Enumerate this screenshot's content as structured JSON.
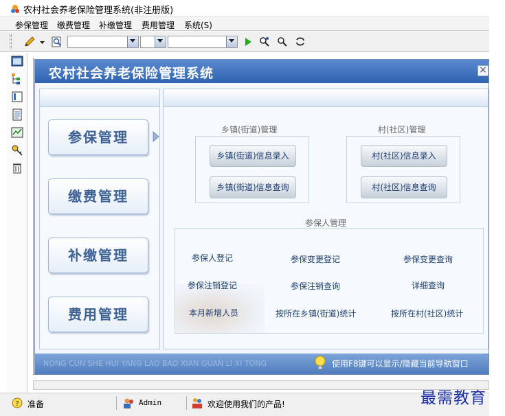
{
  "window": {
    "title": "农村社会养老保险管理系统(非注册版)"
  },
  "menubar": {
    "items": [
      "参保管理",
      "缴费管理",
      "补缴管理",
      "费用管理",
      "系统(S)"
    ]
  },
  "panel": {
    "title": "农村社会养老保险管理系统",
    "close": "×",
    "nav": [
      "参保管理",
      "缴费管理",
      "补缴管理",
      "费用管理"
    ],
    "township_group": {
      "title": "乡镇(街道)管理",
      "buttons": [
        "乡镇(街道)信息录入",
        "乡镇(街道)信息查询"
      ]
    },
    "village_group": {
      "title": "村(社区)管理",
      "buttons": [
        "村(社区)信息录入",
        "村(社区)信息查询"
      ]
    },
    "insured_group": {
      "title": "参保人管理",
      "links": [
        "参保人登记",
        "参保变更登记",
        "参保变更查询",
        "参保注销登记",
        "参保注销查询",
        "详细查询",
        "本月新增人员",
        "按所在乡镇(街道)统计",
        "按所在村(社区)统计"
      ]
    },
    "footer_marquee": "NONG CUN SHE HUI YANG LAO BAO XIAN GUAN LI XI TONG",
    "footer_tip": "使用F8键可以显示/隐藏当前导航窗口"
  },
  "statusbar": {
    "state": "准备",
    "user": "Admin",
    "welcome": "欢迎使用我们的产品!"
  },
  "watermark": "最需教育",
  "colors": {
    "header": "#3a6eb8",
    "nav_text": "#3e6294",
    "link_text": "#1e3f70",
    "watermark": "#1a2fa8"
  },
  "icons": [
    "app-icon",
    "pencil-icon",
    "search-doc-icon",
    "run-icon",
    "find-user-icon",
    "find-icon",
    "refresh-icon",
    "bulb-icon",
    "users-icon",
    "key-icon"
  ]
}
